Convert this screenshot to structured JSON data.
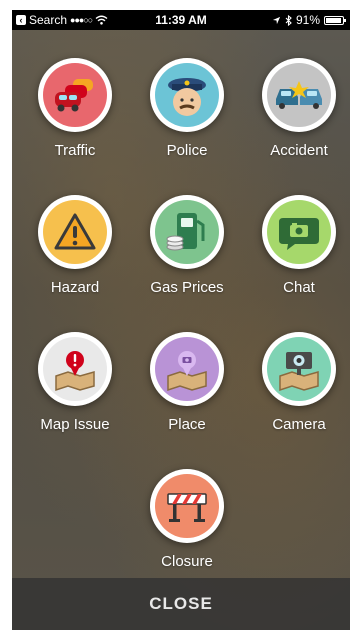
{
  "status_bar": {
    "back_label": "Search",
    "signal": "●●●○○",
    "time": "11:39 AM",
    "battery": "91%"
  },
  "reports": [
    {
      "label": "Traffic",
      "icon": "traffic-icon",
      "color": "#e8676d"
    },
    {
      "label": "Police",
      "icon": "police-icon",
      "color": "#6cc4d6"
    },
    {
      "label": "Accident",
      "icon": "accident-icon",
      "color": "#c4c4c4"
    },
    {
      "label": "Hazard",
      "icon": "hazard-icon",
      "color": "#f6c04d"
    },
    {
      "label": "Gas Prices",
      "icon": "gas-pump-icon",
      "color": "#7ec48e"
    },
    {
      "label": "Chat",
      "icon": "chat-icon",
      "color": "#a6d86b"
    },
    {
      "label": "Map Issue",
      "icon": "map-issue-icon",
      "color": "#e9e9e9"
    },
    {
      "label": "Place",
      "icon": "place-icon",
      "color": "#b993d6"
    },
    {
      "label": "Camera",
      "icon": "camera-icon",
      "color": "#7fd3b4"
    },
    {
      "label": "Closure",
      "icon": "closure-icon",
      "color": "#f08b6a"
    }
  ],
  "close_label": "CLOSE"
}
